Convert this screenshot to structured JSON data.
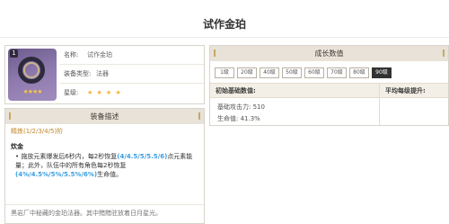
{
  "page": {
    "title": "试作金珀"
  },
  "info": {
    "badge_number": "1",
    "rarity_stars": "★★★★",
    "rows": [
      {
        "label": "名称:",
        "value": "试作金珀"
      },
      {
        "label": "装备类型:",
        "value": "法器"
      },
      {
        "label": "星级:",
        "value": "★ ★ ★ ★"
      }
    ]
  },
  "description": {
    "header": "装备描述",
    "refine": "精炼(1/2/3/4/5)阶",
    "skill_name": "炊金",
    "skill_parts": [
      "• 施放元素爆发后6秒内，每2秒恢复",
      "(4/4.5/5/5.5/6)",
      "点元素能量；此外，队伍中的所有角色每2秒恢复",
      "(4%/4.5%/5%/5.5%/6%)",
      "生命值。"
    ],
    "flavor": "黑岩厂中秘藏的金珀法器。其中黯黯驻放着日月星光。"
  },
  "growth": {
    "header": "成长数值",
    "levels": [
      "1级",
      "20级",
      "40级",
      "50级",
      "60级",
      "70级",
      "80级",
      "90级"
    ],
    "active_level": "90级",
    "col_base": "初始基础数值:",
    "col_avg": "平均每级提升:",
    "stats": [
      "基础攻击力: 510",
      "生命值: 41.3%"
    ]
  },
  "colors": {
    "accent_orange": "#c0852a",
    "highlight_blue": "#3a9ee0",
    "header_beige": "#e8e2d8"
  }
}
